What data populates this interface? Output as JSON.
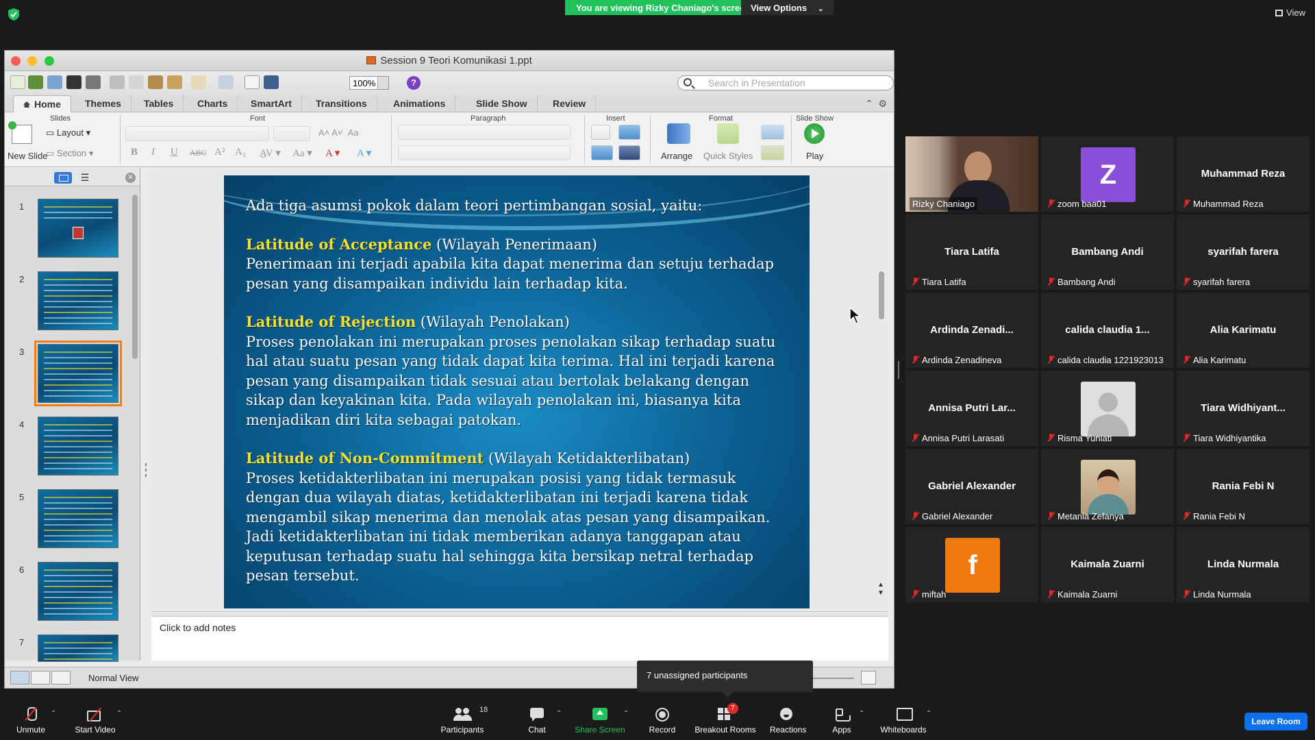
{
  "zoom_meeting": {
    "viewing_banner": "You are viewing Rizky Chaniago's screen",
    "view_options": "View Options",
    "view_label": "View",
    "leave_room": "Leave Room",
    "tooltip": "7 unassigned participants",
    "toolbar": {
      "unmute": "Unmute",
      "start_video": "Start Video",
      "participants": "Participants",
      "participants_count": "18",
      "chat": "Chat",
      "share_screen": "Share Screen",
      "record": "Record",
      "breakout_rooms": "Breakout Rooms",
      "breakout_badge": "7",
      "reactions": "Reactions",
      "apps": "Apps",
      "whiteboards": "Whiteboards"
    },
    "gallery": [
      {
        "label": "Rizky Chaniago",
        "display": "",
        "kind": "video"
      },
      {
        "label": "zoom baa01",
        "display": "Z",
        "kind": "letter",
        "color": "#8a4fd6"
      },
      {
        "label": "Muhammad Reza",
        "display": "Muhammad Reza",
        "kind": "name"
      },
      {
        "label": "Tiara Latifa",
        "display": "Tiara Latifa",
        "kind": "name"
      },
      {
        "label": "Bambang Andi",
        "display": "Bambang Andi",
        "kind": "name"
      },
      {
        "label": "syarifah farera",
        "display": "syarifah farera",
        "kind": "name"
      },
      {
        "label": "Ardinda Zenadineva",
        "display": "Ardinda  Zenadi...",
        "kind": "name"
      },
      {
        "label": "calida claudia 1221923013",
        "display": "calida claudia  1...",
        "kind": "name"
      },
      {
        "label": "Alia Karimatu",
        "display": "Alia Karimatu",
        "kind": "name"
      },
      {
        "label": "Annisa Putri Larasati",
        "display": "Annisa Putri Lar...",
        "kind": "name"
      },
      {
        "label": "Risma Yuniati",
        "display": "",
        "kind": "blank"
      },
      {
        "label": "Tiara Widhiyantika",
        "display": "Tiara  Widhiyant...",
        "kind": "name"
      },
      {
        "label": "Gabriel Alexander",
        "display": "Gabriel Alexander",
        "kind": "name"
      },
      {
        "label": "Metania Zefanya",
        "display": "",
        "kind": "photo"
      },
      {
        "label": "Rania Febi N",
        "display": "Rania Febi N",
        "kind": "name"
      },
      {
        "label": "miftah",
        "display": "f",
        "kind": "letter",
        "color": "#f07a0f"
      },
      {
        "label": "Kaimala Zuarni",
        "display": "Kaimala Zuarni",
        "kind": "name"
      },
      {
        "label": "Linda Nurmala",
        "display": "Linda Nurmala",
        "kind": "name"
      }
    ]
  },
  "ppt": {
    "window_title": "Session 9 Teori Komunikasi 1.ppt",
    "zoom": "100%",
    "search_placeholder": "Search in Presentation",
    "tabs": [
      "Home",
      "Themes",
      "Tables",
      "Charts",
      "SmartArt",
      "Transitions",
      "Animations",
      "Slide Show",
      "Review"
    ],
    "groups": {
      "slides": "Slides",
      "font": "Font",
      "paragraph": "Paragraph",
      "insert": "Insert",
      "format": "Format",
      "slide_show": "Slide Show"
    },
    "buttons": {
      "new_slide": "New Slide",
      "layout": "Layout",
      "section": "Section",
      "arrange": "Arrange",
      "quick_styles": "Quick Styles",
      "play": "Play"
    },
    "thumb_numbers": [
      "1",
      "2",
      "3",
      "4",
      "5",
      "6",
      "7"
    ],
    "selected_slide": 3,
    "notes_placeholder": "Click to add notes",
    "status_view": "Normal View",
    "slide": {
      "intro": "Ada tiga asumsi pokok dalam teori pertimbangan sosial, yaitu:",
      "s1_title": "Latitude of Acceptance",
      "s1_sub": " (Wilayah Penerimaan)",
      "s1_body": "Penerimaan ini terjadi apabila kita dapat menerima dan setuju terhadap pesan yang disampaikan individu lain terhadap kita.",
      "s2_title": "Latitude of Rejection",
      "s2_sub": " (Wilayah Penolakan)",
      "s2_body": "Proses penolakan ini merupakan proses penolakan sikap terhadap suatu hal atau suatu pesan yang tidak dapat kita terima. Hal ini terjadi karena pesan yang disampaikan tidak sesuai atau bertolak belakang dengan sikap dan keyakinan kita. Pada wilayah penolakan ini, biasanya kita menjadikan diri kita sebagai patokan.",
      "s3_title": "Latitude of Non-Commitment",
      "s3_sub": " (Wilayah Ketidakterlibatan)",
      "s3_body": "Proses ketidakterlibatan ini merupakan posisi yang tidak termasuk dengan dua wilayah diatas, ketidakterlibatan ini terjadi karena tidak mengambil sikap menerima dan menolak atas pesan yang disampaikan. Jadi ketidakterlibatan ini tidak memberikan adanya tanggapan atau keputusan terhadap suatu hal sehingga kita bersikap netral terhadap pesan tersebut."
    }
  }
}
